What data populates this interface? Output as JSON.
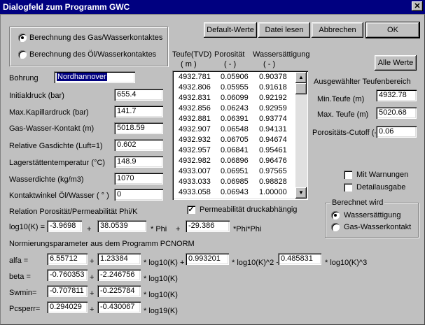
{
  "window": {
    "title": "Dialogfeld zum Programm GWC",
    "close": "✕"
  },
  "buttons": {
    "default": "Default-Werte",
    "load": "Datei lesen",
    "cancel": "Abbrechen",
    "ok": "OK",
    "all": "Alle Werte"
  },
  "mode": {
    "gas_water": "Berechnung des Gas/Wasserkontaktes",
    "oil_water": "Berechnung des Öl/Wasserkontaktes"
  },
  "params": {
    "well_label": "Bohrung",
    "well_value": "Nordhannover",
    "p0_label": "Initialdruck (bar)",
    "p0_value": "655.4",
    "pcmax_label": "Max.Kapillardruck (bar)",
    "pcmax_value": "141.7",
    "gwc_label": "Gas-Wasser-Kontakt (m)",
    "gwc_value": "5018.59",
    "rgd_label": "Relative Gasdichte (Luft=1)",
    "rgd_value": "0.602",
    "temp_label": "Lagerstättentemperatur (°C)",
    "temp_value": "148.9",
    "wd_label": "Wasserdichte (kg/m3)",
    "wd_value": "1070",
    "angle_label": "Kontaktwinkel Öl/Wasser ( ° )",
    "angle_value": "0"
  },
  "table": {
    "headers": [
      "Teufe(TVD)",
      "Porosität",
      "Wassersättigung"
    ],
    "units": [
      "( m )",
      "( - )",
      "( - )"
    ],
    "rows": [
      [
        "4932.781",
        "0.05906",
        "0.90378"
      ],
      [
        "4932.806",
        "0.05955",
        "0.91618"
      ],
      [
        "4932.831",
        "0.06099",
        "0.92192"
      ],
      [
        "4932.856",
        "0.06243",
        "0.92959"
      ],
      [
        "4932.881",
        "0.06391",
        "0.93774"
      ],
      [
        "4932.907",
        "0.06548",
        "0.94131"
      ],
      [
        "4932.932",
        "0.06705",
        "0.94674"
      ],
      [
        "4932.957",
        "0.06841",
        "0.95461"
      ],
      [
        "4932.982",
        "0.06896",
        "0.96476"
      ],
      [
        "4933.007",
        "0.06951",
        "0.97565"
      ],
      [
        "4933.033",
        "0.06985",
        "0.98828"
      ],
      [
        "4933.058",
        "0.06943",
        "1.00000"
      ]
    ]
  },
  "range": {
    "title": "Ausgewählter Teufenbereich",
    "min_label": "Min.Teufe (m)",
    "min_value": "4932.78",
    "max_label": "Max. Teufe (m)",
    "max_value": "5020.68",
    "cutoff_label": "Porositäts-Cutoff (-)",
    "cutoff_value": "0.06"
  },
  "options": {
    "warnings": "Mit Warnungen",
    "detail": "Detailausgabe"
  },
  "computed": {
    "title": "Berechnet wird",
    "ws": "Wassersättigung",
    "gwk": "Gas-Wasserkontakt"
  },
  "relation": {
    "title": "Relation Porosität/Permeabilität Phi/K",
    "pressure_dep": "Permeabilität druckabhängig",
    "log_label": "log10(K) =",
    "a": "-3.9698",
    "plus": "+",
    "b": "38.0539",
    "phi": "* Phi",
    "plus2": "+",
    "c": "-29.386",
    "phiphi": "*Phi*Phi"
  },
  "norm": {
    "title": "Normierungsparameter aus dem Programm PCNORM",
    "alfa_label": "alfa =",
    "alfa": [
      "6.55712",
      "1.23384",
      "0.993201",
      "0.485831"
    ],
    "beta_label": "beta =",
    "beta": [
      "-0.760353",
      "-2.246756"
    ],
    "swmin_label": "Swmin=",
    "swmin": [
      "-0.707811",
      "-0.225784"
    ],
    "pcsperr_label": "Pcsperr=",
    "pcsperr": [
      "0.294029",
      "-0.430067"
    ],
    "plus": "+",
    "t_log": "* log10(K) +",
    "t_log2": "* log10(K)^2 +",
    "t_log3": "* log10(K)^3",
    "t_logk": "* log10(K)",
    "t_log19": "* log19(K)"
  }
}
